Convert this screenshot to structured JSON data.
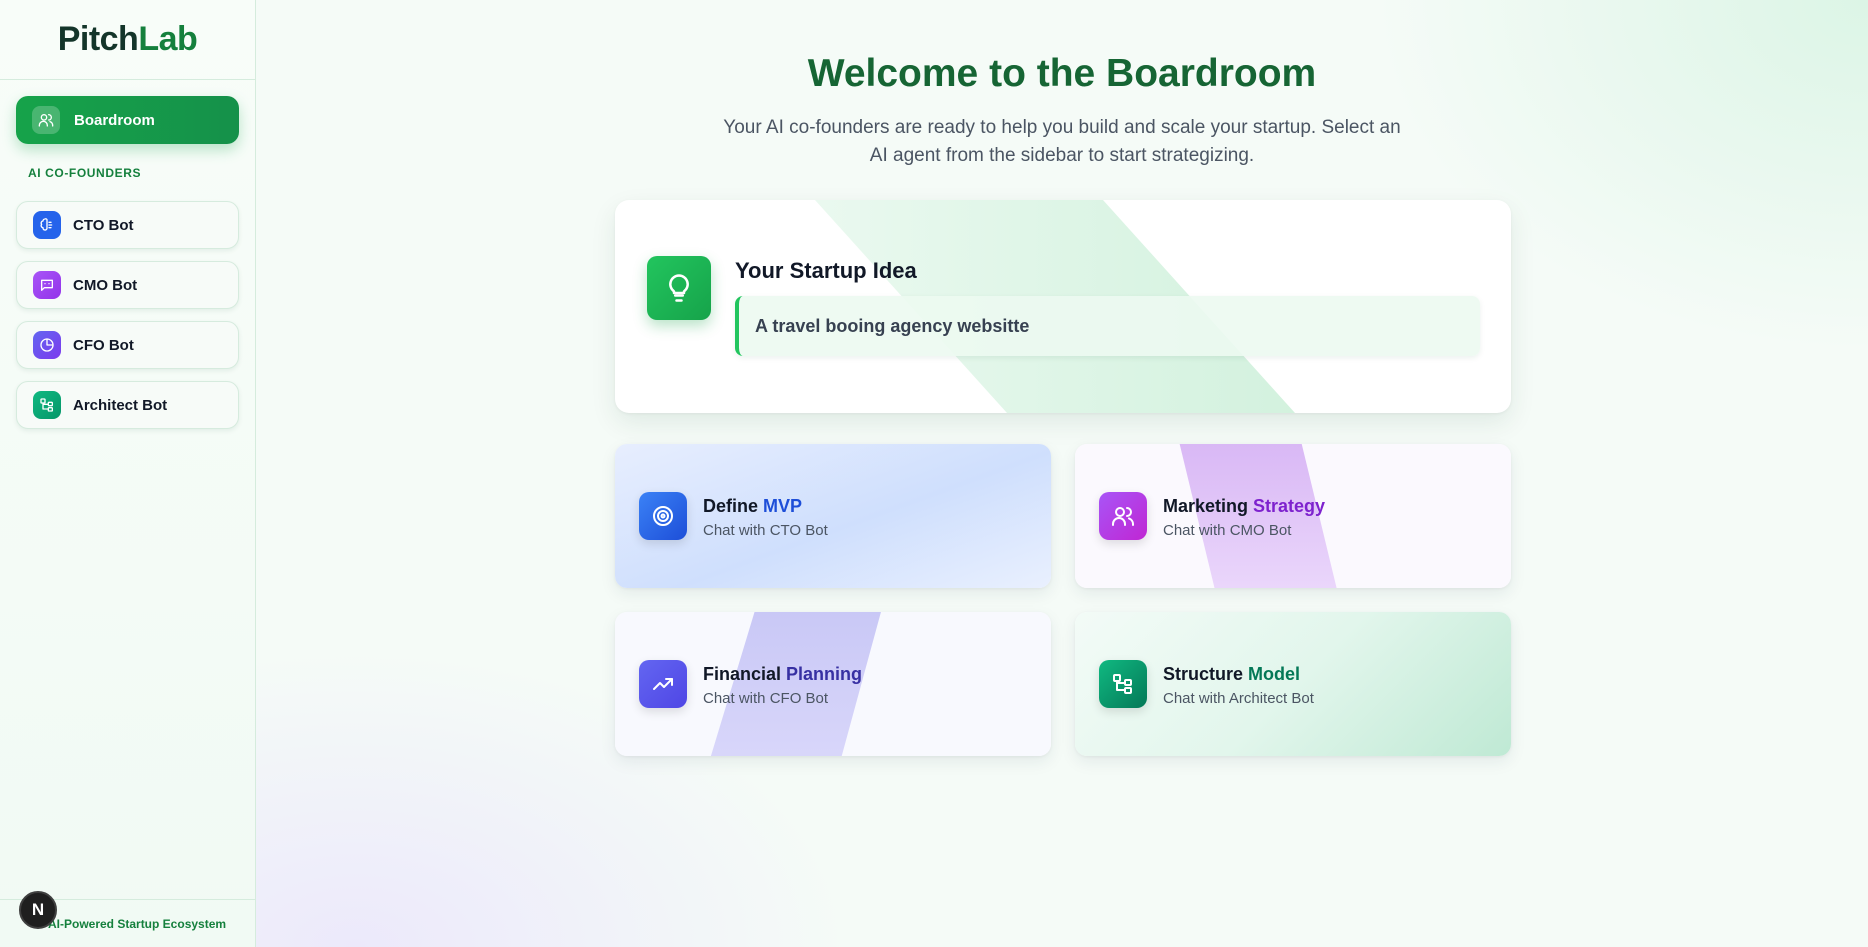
{
  "sidebar": {
    "logo_part1": "Pitch",
    "logo_part2": "Lab",
    "active_item": {
      "label": "Boardroom",
      "icon": "users-icon"
    },
    "section_label": "AI CO-FOUNDERS",
    "bots": [
      {
        "label": "CTO Bot",
        "icon": "brain-icon",
        "color": "#2563eb"
      },
      {
        "label": "CMO Bot",
        "icon": "chat-bot-icon",
        "color": "#9333ea"
      },
      {
        "label": "CFO Bot",
        "icon": "pie-chart-icon",
        "color": "#6d28d9"
      },
      {
        "label": "Architect Bot",
        "icon": "tree-structure-icon",
        "color": "#059669"
      }
    ],
    "footer_text": "AI-Powered Startup Ecosystem",
    "badge_letter": "N"
  },
  "main": {
    "title": "Welcome to the Boardroom",
    "subtitle": "Your AI co-founders are ready to help you build and scale your startup. Select an AI agent from the sidebar to start strategizing.",
    "idea": {
      "heading": "Your Startup Idea",
      "value": "A travel booing agency websitte",
      "icon": "lightbulb-icon"
    },
    "actions": [
      {
        "title_a": "Define ",
        "title_b": "MVP",
        "sub": "Chat with CTO Bot",
        "icon": "target-icon",
        "accent": "#1d4ed8"
      },
      {
        "title_a": "Marketing ",
        "title_b": "Strategy",
        "sub": "Chat with CMO Bot",
        "icon": "users-icon",
        "accent": "#7e22ce"
      },
      {
        "title_a": "Financial ",
        "title_b": "Planning",
        "sub": "Chat with CFO Bot",
        "icon": "trending-up-icon",
        "accent": "#3730a3"
      },
      {
        "title_a": "Structure ",
        "title_b": "Model",
        "sub": "Chat with Architect Bot",
        "icon": "tree-structure-icon",
        "accent": "#047857"
      }
    ]
  }
}
